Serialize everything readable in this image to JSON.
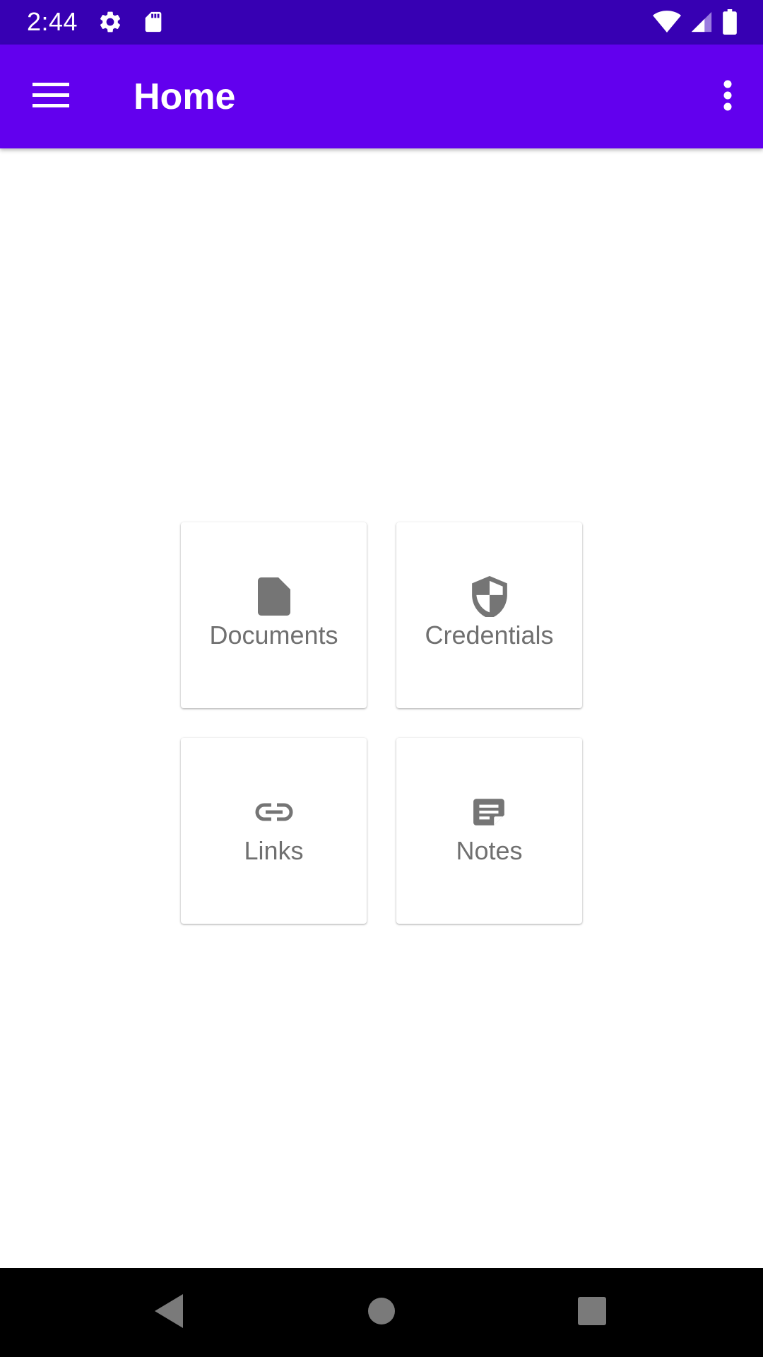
{
  "status_bar": {
    "time": "2:44",
    "left_icons": [
      "settings-icon",
      "sd-card-icon"
    ],
    "right_icons": [
      "wifi-icon",
      "signal-icon",
      "battery-icon"
    ]
  },
  "app_bar": {
    "title": "Home",
    "menu_icon": "hamburger-menu-icon",
    "overflow_icon": "more-vert-icon",
    "background": "#6200ee"
  },
  "tiles": [
    {
      "label": "Documents",
      "icon": "document-icon"
    },
    {
      "label": "Credentials",
      "icon": "shield-icon"
    },
    {
      "label": "Links",
      "icon": "link-icon"
    },
    {
      "label": "Notes",
      "icon": "note-icon"
    }
  ],
  "nav_bar": {
    "buttons": [
      "back-icon",
      "home-icon",
      "recents-icon"
    ]
  },
  "colors": {
    "status_bar": "#3700b3",
    "primary": "#6200ee",
    "tile_icon": "#757575",
    "tile_text": "#707070"
  }
}
